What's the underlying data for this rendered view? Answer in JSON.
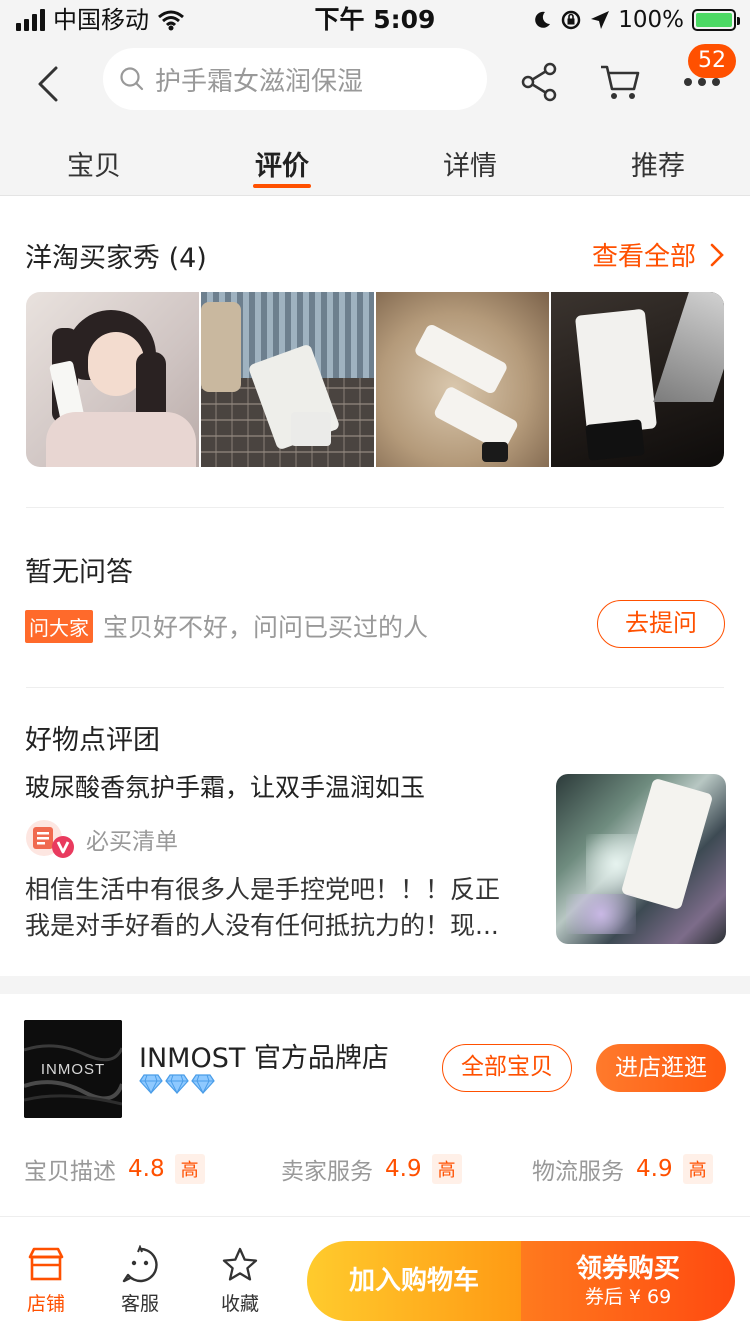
{
  "status_bar": {
    "carrier": "中国移动",
    "time": "下午 5:09",
    "battery": "100%",
    "battery_level": 1.0
  },
  "header": {
    "search_placeholder": "护手霜女滋润保湿",
    "cart_badge": "52",
    "icons": [
      "back-arrow-icon",
      "search-icon",
      "share-icon",
      "cart-icon",
      "more-icon"
    ]
  },
  "tabs": [
    {
      "label": "宝贝",
      "active": false
    },
    {
      "label": "评价",
      "active": true
    },
    {
      "label": "详情",
      "active": false
    },
    {
      "label": "推荐",
      "active": false
    }
  ],
  "buyer_show": {
    "title": "洋淘买家秀 (4)",
    "view_all": "查看全部"
  },
  "qa": {
    "title": "暂无问答",
    "tag": "问大家",
    "prompt": "宝贝好不好，问问已买过的人",
    "ask_button": "去提问"
  },
  "review_group": {
    "title": "好物点评团",
    "headline": "玻尿酸香氛护手霜，让双手温润如玉",
    "author": "必买清单",
    "body_line1": "相信生活中有很多人是手控党吧！！！反正",
    "body_line2": "我是对手好看的人没有任何抵抗力的！现..."
  },
  "shop": {
    "logo_text": "INMOST",
    "name": "INMOST 官方品牌店",
    "diamond_count": 3,
    "all_items_button": "全部宝贝",
    "visit_button": "进店逛逛",
    "ratings": [
      {
        "label": "宝贝描述",
        "score": "4.8",
        "level": "高"
      },
      {
        "label": "卖家服务",
        "score": "4.9",
        "level": "高"
      },
      {
        "label": "物流服务",
        "score": "4.9",
        "level": "高"
      }
    ]
  },
  "bottom_bar": {
    "store": "店铺",
    "service": "客服",
    "favorite": "收藏",
    "add_to_cart": "加入购物车",
    "buy": "领券购买",
    "buy_price": "券后 ¥ 69"
  },
  "colors": {
    "accent": "#ff5000",
    "tab_bg": "#f4f4f4"
  }
}
